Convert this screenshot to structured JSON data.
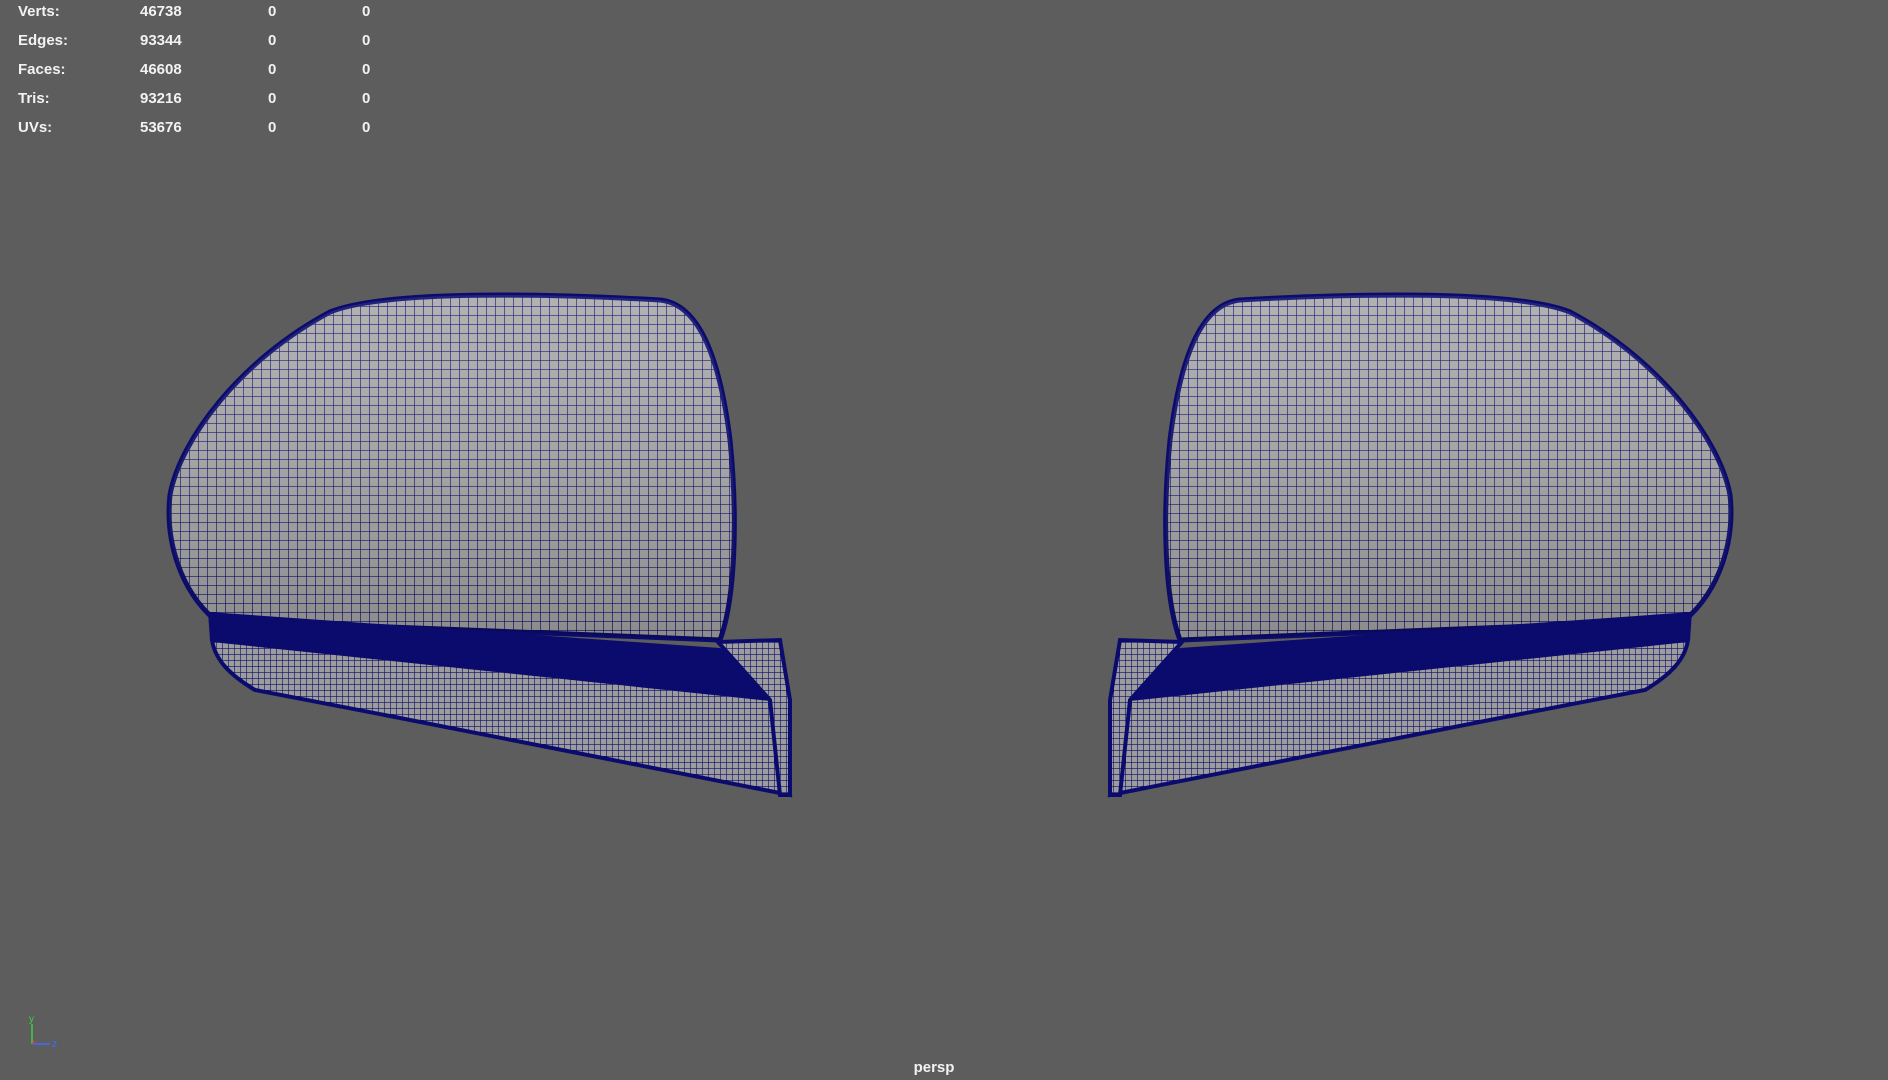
{
  "hud": {
    "rows": [
      {
        "label": "Verts:",
        "count": "46738",
        "selected": "0",
        "component": "0"
      },
      {
        "label": "Edges:",
        "count": "93344",
        "selected": "0",
        "component": "0"
      },
      {
        "label": "Faces:",
        "count": "46608",
        "selected": "0",
        "component": "0"
      },
      {
        "label": "Tris:",
        "count": "93216",
        "selected": "0",
        "component": "0"
      },
      {
        "label": "UVs:",
        "count": "53676",
        "selected": "0",
        "component": "0"
      }
    ]
  },
  "viewport": {
    "camera": "persp",
    "background_color": "#5d5d5d",
    "wireframe_color": "#0b0b6e",
    "surface_color": "#a9a9a9"
  },
  "axis_gizmo": {
    "y_label": "y",
    "z_label": "z",
    "y_color": "#3cd23c",
    "z_color": "#3c6cff",
    "x_color": "#e03c3c"
  },
  "objects": [
    {
      "name": "mirror-left",
      "shape": "car-side-mirror"
    },
    {
      "name": "mirror-right",
      "shape": "car-side-mirror"
    }
  ]
}
